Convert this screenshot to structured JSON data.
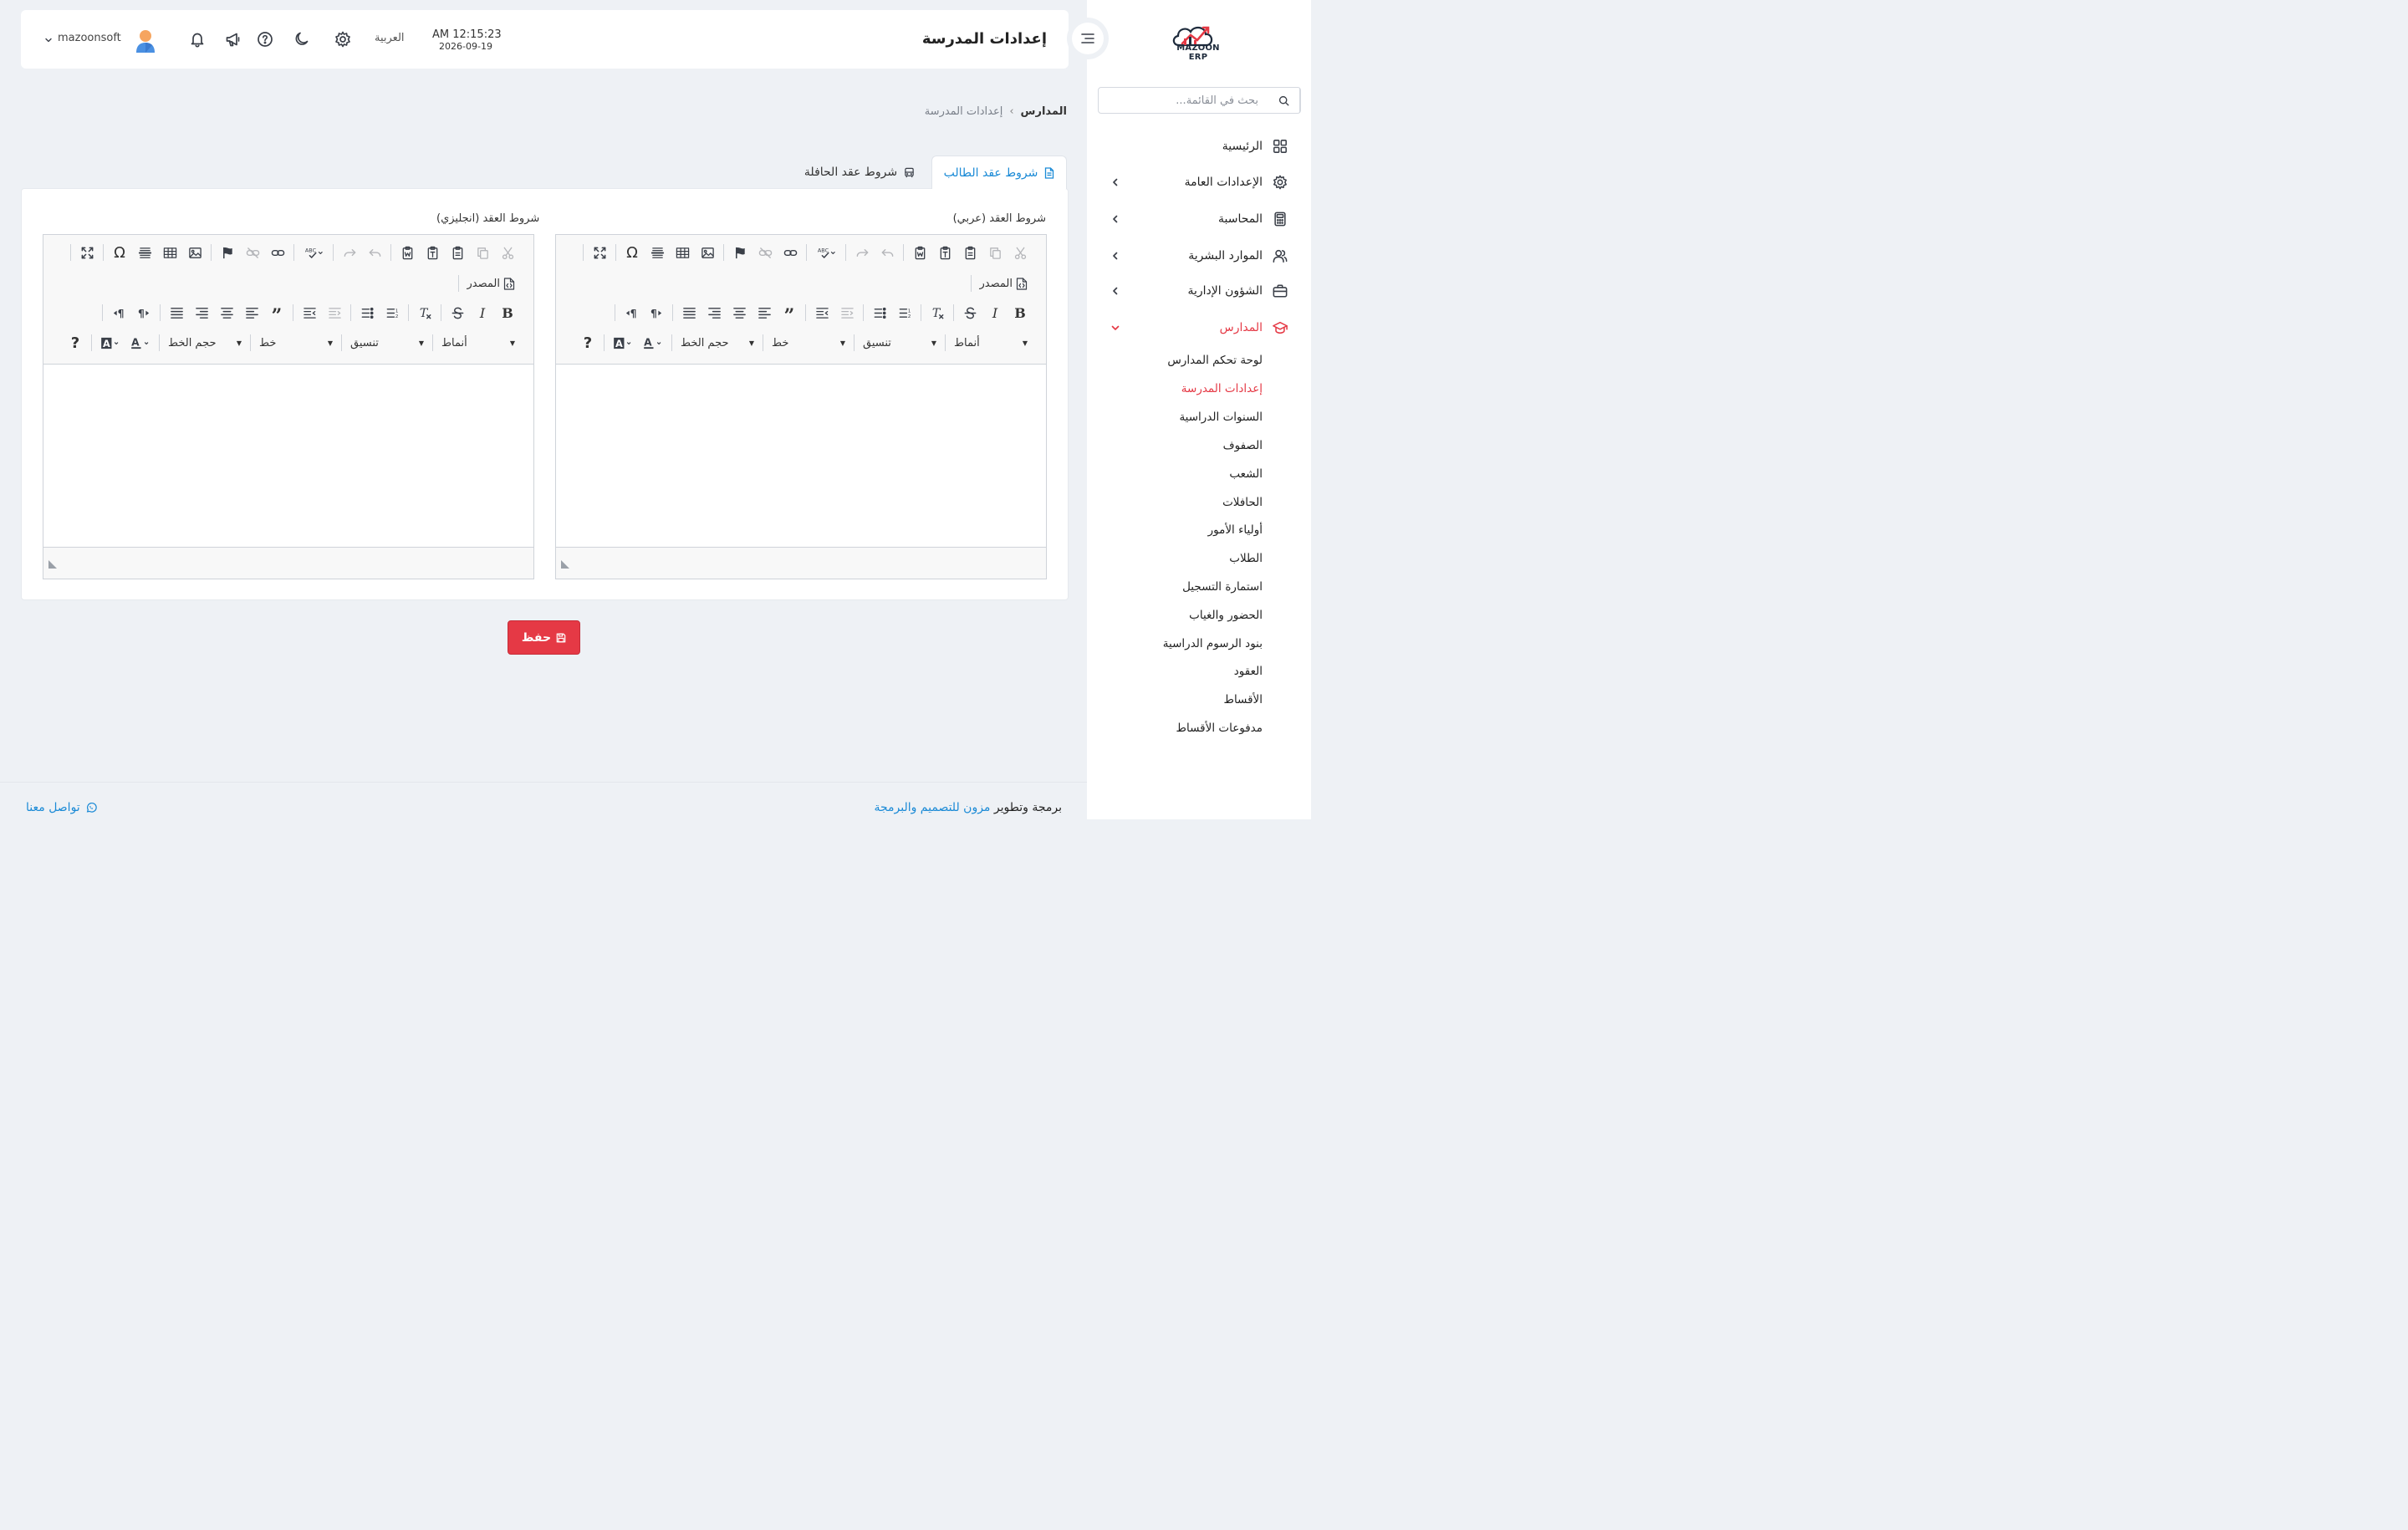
{
  "brand": {
    "name": "MAZOON ERP",
    "accent": "#e53945",
    "link": "#1a8ad6"
  },
  "sidebar": {
    "search_placeholder": "بحث في القائمة...",
    "items": [
      {
        "label": "الرئيسية",
        "icon": "grid-icon"
      },
      {
        "label": "الإعدادات العامة",
        "icon": "gear-icon"
      },
      {
        "label": "المحاسبة",
        "icon": "calculator-icon"
      },
      {
        "label": "الموارد البشرية",
        "icon": "users-icon"
      },
      {
        "label": "الشؤون الإدارية",
        "icon": "briefcase-icon"
      },
      {
        "label": "المدارس",
        "icon": "graduation-cap-icon"
      }
    ],
    "schools_sub": [
      "لوحة تحكم المدارس",
      "إعدادات المدرسة",
      "السنوات الدراسية",
      "الصفوف",
      "الشعب",
      "الحافلات",
      "أولياء الأمور",
      "الطلاب",
      "استمارة التسجيل",
      "الحضور والغياب",
      "بنود الرسوم الدراسية",
      "العقود",
      "الأقساط",
      "مدفوعات الأقساط"
    ]
  },
  "header": {
    "title": "إعدادات المدرسة",
    "time": "AM 12:15:23",
    "date": "2026-09-19",
    "language": "العربية",
    "username": "mazoonsoft"
  },
  "breadcrumb": {
    "parent": "المدارس",
    "current": "إعدادات المدرسة"
  },
  "tabs": {
    "student": "شروط عقد الطالب",
    "bus": "شروط عقد الحافلة"
  },
  "editors": {
    "arabic_label": "شروط العقد (عربي)",
    "english_label": "شروط العقد (انجليزي)",
    "source_label": "المصدر",
    "styles_label": "أنماط",
    "format_label": "تنسيق",
    "font_label": "خط",
    "size_label": "حجم الخط",
    "bold": "B",
    "italic": "I",
    "help": "?"
  },
  "save_label": "حفظ",
  "footer": {
    "credit_prefix": "برمجة وتطوير",
    "credit_link": "مزون للتصميم والبرمجة",
    "contact": "تواصل معنا"
  }
}
